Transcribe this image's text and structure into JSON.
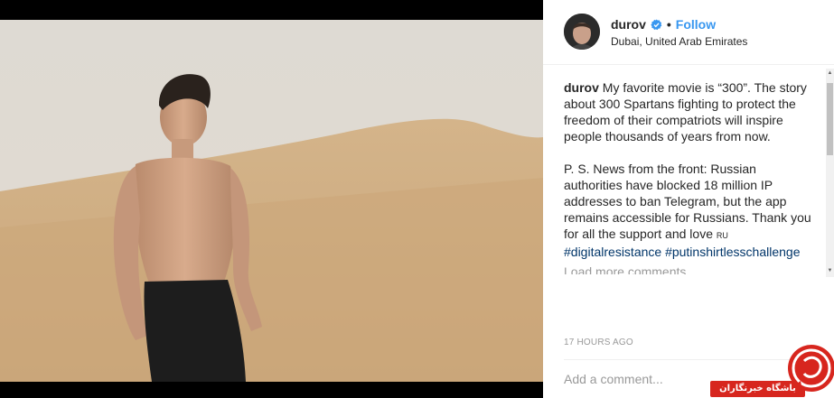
{
  "post": {
    "username": "durov",
    "separator": "•",
    "follow_label": "Follow",
    "location": "Dubai, United Arab Emirates",
    "caption_author": "durov",
    "caption_paragraph1": " My favorite movie is “300”. The story about 300 Spartans fighting to protect the freedom of their compatriots will inspire people thousands of years from now.",
    "caption_paragraph2": "P. S. News from the front: Russian authorities have blocked 18 million IP addresses to ban Telegram, but the app remains accessible for Russians. Thank you for all the support and love",
    "caption_flag": "RU",
    "hashtags": [
      "#digitalresistance",
      "#putinshirtlesschallenge"
    ],
    "load_more_label": "Load more comments",
    "timestamp": "17 HOURS AGO",
    "comment_placeholder": "Add a comment..."
  },
  "watermark": {
    "banner_text": "باشگاه خبرنگاران"
  },
  "colors": {
    "link_blue": "#3897f0",
    "hashtag_blue": "#003569",
    "text": "#262626",
    "muted": "#999999",
    "watermark_red": "#d7261e"
  },
  "icons": {
    "verified": "verified-badge-icon"
  }
}
